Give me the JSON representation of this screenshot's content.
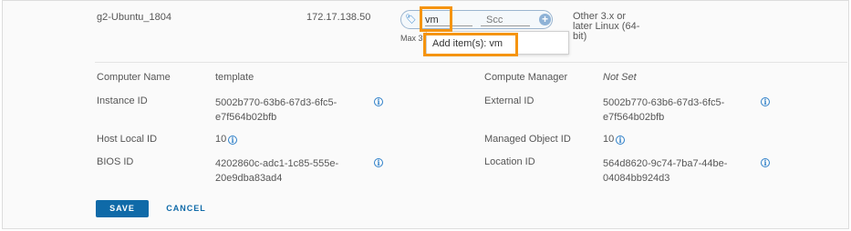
{
  "vm_row": {
    "name": "g2-Ubuntu_1804",
    "ip": "172.17.138.50",
    "os": [
      "Other 3.x or",
      "later Linux (64-",
      "bit)"
    ]
  },
  "tag_editor": {
    "tag_value": "vm",
    "scope_placeholder": "Scc",
    "max_note": "Max 3",
    "suggestion": "Add item(s): vm"
  },
  "details": {
    "computer_name_label": "Computer Name",
    "computer_name_value": "template",
    "instance_id_label": "Instance ID",
    "instance_id_value": [
      "5002b770-63b6-67d3-6fc5-",
      "e7f564b02bfb"
    ],
    "host_local_id_label": "Host Local ID",
    "host_local_id_value": "10",
    "bios_id_label": "BIOS ID",
    "bios_id_value": [
      "4202860c-adc1-1c85-555e-",
      "20e9dba83ad4"
    ],
    "compute_manager_label": "Compute Manager",
    "compute_manager_value": "Not Set",
    "external_id_label": "External ID",
    "external_id_value": [
      "5002b770-63b6-67d3-6fc5-",
      "e7f564b02bfb"
    ],
    "managed_object_id_label": "Managed Object ID",
    "managed_object_id_value": "10",
    "location_id_label": "Location ID",
    "location_id_value": [
      "564d8620-9c74-7ba7-44be-",
      "04084bb924d3"
    ]
  },
  "actions": {
    "save": "SAVE",
    "cancel": "CANCEL"
  },
  "icons": {
    "info": "info-icon",
    "tag": "tag-icon",
    "add": "plus-circle-icon"
  },
  "colors": {
    "accent": "#0f6aa8",
    "highlight": "#f5940f",
    "info": "#2f80c9"
  }
}
